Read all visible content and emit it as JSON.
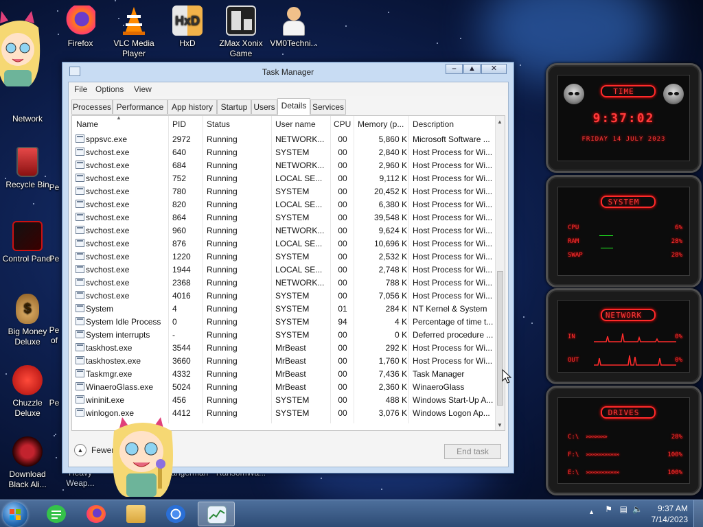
{
  "desktop": {
    "icons": [
      {
        "label": "Network",
        "name": "desktop-icon-network"
      },
      {
        "label": "Recycle Bin",
        "name": "desktop-icon-recycle-bin"
      },
      {
        "label": "Control Panel",
        "name": "desktop-icon-control-panel"
      },
      {
        "label": "Big Money Deluxe",
        "name": "desktop-icon-big-money-deluxe"
      },
      {
        "label": "Chuzzle Deluxe",
        "name": "desktop-icon-chuzzle-deluxe"
      },
      {
        "label": "Download Black Ali...",
        "name": "desktop-icon-download-black-alienware"
      },
      {
        "label": "Firefox",
        "name": "desktop-icon-firefox"
      },
      {
        "label": "VLC Media Player",
        "name": "desktop-icon-vlc"
      },
      {
        "label": "HxD",
        "name": "desktop-icon-hxd"
      },
      {
        "label": "ZMax Xonix Game",
        "name": "desktop-icon-zmax-xonix"
      },
      {
        "label": "VM0Techni...",
        "name": "desktop-icon-vm0technician"
      }
    ],
    "partial_labels": {
      "heavy": "Heavy Weap...",
      "hangerman": "Hangerman",
      "ransomwa": "RansomWa...",
      "c": "C",
      "pe1": "Pe",
      "pe2": "Pe",
      "pe3": "Pe",
      "pe4": "Pe",
      "of": "of"
    }
  },
  "task_manager": {
    "title": "Task Manager",
    "menu": [
      "File",
      "Options",
      "View"
    ],
    "tabs": [
      "Processes",
      "Performance",
      "App history",
      "Startup",
      "Users",
      "Details",
      "Services"
    ],
    "active_tab": "Details",
    "columns": [
      "Name",
      "PID",
      "Status",
      "User name",
      "CPU",
      "Memory (p...",
      "Description"
    ],
    "rows": [
      [
        "sppsvc.exe",
        "2972",
        "Running",
        "NETWORK...",
        "00",
        "5,860 K",
        "Microsoft Software ..."
      ],
      [
        "svchost.exe",
        "640",
        "Running",
        "SYSTEM",
        "00",
        "2,840 K",
        "Host Process for Wi..."
      ],
      [
        "svchost.exe",
        "684",
        "Running",
        "NETWORK...",
        "00",
        "2,960 K",
        "Host Process for Wi..."
      ],
      [
        "svchost.exe",
        "752",
        "Running",
        "LOCAL SE...",
        "00",
        "9,112 K",
        "Host Process for Wi..."
      ],
      [
        "svchost.exe",
        "780",
        "Running",
        "SYSTEM",
        "00",
        "20,452 K",
        "Host Process for Wi..."
      ],
      [
        "svchost.exe",
        "820",
        "Running",
        "LOCAL SE...",
        "00",
        "6,380 K",
        "Host Process for Wi..."
      ],
      [
        "svchost.exe",
        "864",
        "Running",
        "SYSTEM",
        "00",
        "39,548 K",
        "Host Process for Wi..."
      ],
      [
        "svchost.exe",
        "960",
        "Running",
        "NETWORK...",
        "00",
        "9,624 K",
        "Host Process for Wi..."
      ],
      [
        "svchost.exe",
        "876",
        "Running",
        "LOCAL SE...",
        "00",
        "10,696 K",
        "Host Process for Wi..."
      ],
      [
        "svchost.exe",
        "1220",
        "Running",
        "SYSTEM",
        "00",
        "2,532 K",
        "Host Process for Wi..."
      ],
      [
        "svchost.exe",
        "1944",
        "Running",
        "LOCAL SE...",
        "00",
        "2,748 K",
        "Host Process for Wi..."
      ],
      [
        "svchost.exe",
        "2368",
        "Running",
        "NETWORK...",
        "00",
        "788 K",
        "Host Process for Wi..."
      ],
      [
        "svchost.exe",
        "4016",
        "Running",
        "SYSTEM",
        "00",
        "7,056 K",
        "Host Process for Wi..."
      ],
      [
        "System",
        "4",
        "Running",
        "SYSTEM",
        "01",
        "284 K",
        "NT Kernel & System"
      ],
      [
        "System Idle Process",
        "0",
        "Running",
        "SYSTEM",
        "94",
        "4 K",
        "Percentage of time t..."
      ],
      [
        "System interrupts",
        "-",
        "Running",
        "SYSTEM",
        "00",
        "0 K",
        "Deferred procedure ..."
      ],
      [
        "taskhost.exe",
        "3544",
        "Running",
        "MrBeast",
        "00",
        "292 K",
        "Host Process for Wi..."
      ],
      [
        "taskhostex.exe",
        "3660",
        "Running",
        "MrBeast",
        "00",
        "1,760 K",
        "Host Process for Wi..."
      ],
      [
        "Taskmgr.exe",
        "4332",
        "Running",
        "MrBeast",
        "00",
        "7,436 K",
        "Task Manager"
      ],
      [
        "WinaeroGlass.exe",
        "5024",
        "Running",
        "MrBeast",
        "00",
        "2,360 K",
        "WinaeroGlass"
      ],
      [
        "wininit.exe",
        "456",
        "Running",
        "SYSTEM",
        "00",
        "488 K",
        "Windows Start-Up A..."
      ],
      [
        "winlogon.exe",
        "4412",
        "Running",
        "SYSTEM",
        "00",
        "3,076 K",
        "Windows Logon Ap..."
      ]
    ],
    "fewer_details": "Fewer details",
    "end_task": "End task"
  },
  "widget": {
    "time": {
      "title": "TIME",
      "clock": "9:37:02",
      "date": "FRIDAY 14 JULY 2023"
    },
    "system": {
      "title": "SYSTEM",
      "cpu_label": "CPU",
      "cpu_value": "6%",
      "ram_label": "RAM",
      "ram_value": "28%",
      "swap_label": "SWAP",
      "swap_value": "28%"
    },
    "network": {
      "title": "NETWORK",
      "in_label": "IN",
      "in_value": "0%",
      "out_label": "OUT",
      "out_value": "0%"
    },
    "drives": {
      "title": "DRIVES",
      "items": [
        {
          "label": "C:\\",
          "value": "28%"
        },
        {
          "label": "F:\\",
          "value": "100%"
        },
        {
          "label": "E:\\",
          "value": "100%"
        }
      ]
    }
  },
  "taskbar": {
    "time": "9:37 AM",
    "date": "7/14/2023"
  },
  "colors": {
    "accent_red": "#ff2b2b",
    "taskbar": "#3c5d89",
    "window_frame": "#c8dcf3"
  }
}
